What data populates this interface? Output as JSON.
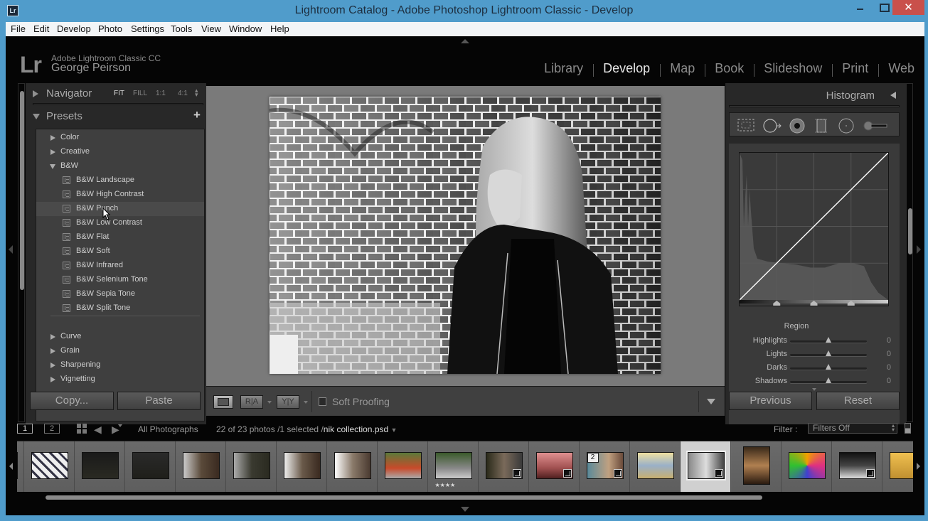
{
  "window": {
    "title": "Lightroom Catalog - Adobe Photoshop Lightroom Classic - Develop",
    "app_icon": "Lr",
    "close_glyph": "✕"
  },
  "menubar": [
    "File",
    "Edit",
    "Develop",
    "Photo",
    "Settings",
    "Tools",
    "View",
    "Window",
    "Help"
  ],
  "identity": {
    "logo": "Lr",
    "product": "Adobe Lightroom Classic CC",
    "user": "George Peirson"
  },
  "modules": [
    {
      "label": "Library",
      "active": false
    },
    {
      "label": "Develop",
      "active": true
    },
    {
      "label": "Map",
      "active": false
    },
    {
      "label": "Book",
      "active": false
    },
    {
      "label": "Slideshow",
      "active": false
    },
    {
      "label": "Print",
      "active": false
    },
    {
      "label": "Web",
      "active": false
    }
  ],
  "left_panel": {
    "navigator": {
      "title": "Navigator",
      "zoom_options": [
        "FIT",
        "FILL",
        "1:1",
        "4:1"
      ],
      "active_zoom": "FIT"
    },
    "presets": {
      "title": "Presets",
      "add_glyph": "+",
      "folders_top": [
        {
          "label": "Color",
          "expanded": false
        },
        {
          "label": "Creative",
          "expanded": false
        },
        {
          "label": "B&W",
          "expanded": true
        }
      ],
      "bw_presets": [
        "B&W Landscape",
        "B&W High Contrast",
        "B&W Punch",
        "B&W Low Contrast",
        "B&W Flat",
        "B&W Soft",
        "B&W Infrared",
        "B&W Selenium Tone",
        "B&W Sepia Tone",
        "B&W Split Tone"
      ],
      "hovered_preset": "B&W Punch",
      "folders_bottom": [
        {
          "label": "Curve",
          "expanded": false
        },
        {
          "label": "Grain",
          "expanded": false
        },
        {
          "label": "Sharpening",
          "expanded": false
        },
        {
          "label": "Vignetting",
          "expanded": false
        }
      ]
    },
    "copy_label": "Copy...",
    "paste_label": "Paste"
  },
  "toolbar": {
    "view_mode_icon": "loupe-view-icon",
    "before_after_ra": "R|A",
    "before_after_yy": "Y|Y",
    "soft_proofing_label": "Soft Proofing",
    "soft_proofing_checked": false
  },
  "right_panel": {
    "histogram_title": "Histogram",
    "tools": [
      "crop-overlay-icon",
      "spot-removal-icon",
      "red-eye-icon",
      "graduated-filter-icon",
      "radial-filter-icon",
      "adjustment-brush-icon"
    ],
    "tone_curve": {
      "region_title": "Region",
      "sliders": [
        {
          "label": "Highlights",
          "value": 0
        },
        {
          "label": "Lights",
          "value": 0
        },
        {
          "label": "Darks",
          "value": 0
        },
        {
          "label": "Shadows",
          "value": 0
        }
      ],
      "split_points": [
        0.25,
        0.5,
        0.75
      ]
    },
    "previous_label": "Previous",
    "reset_label": "Reset"
  },
  "filmstrip_bar": {
    "screen1": "1",
    "screen2": "2",
    "source": "All Photographs",
    "count_text": "22 of 23 photos /1 selected /",
    "filename": "nik collection.psd",
    "filter_label": "Filter :",
    "filter_value": "Filters Off"
  },
  "filmstrip": {
    "thumbnails": [
      {
        "desc": "partial white",
        "badge": true,
        "selected": false
      },
      {
        "desc": "cat on patterned wall",
        "badge": false,
        "selected": false
      },
      {
        "desc": "dark dining room",
        "badge": false,
        "selected": false
      },
      {
        "desc": "dark dining room 2",
        "badge": false,
        "selected": false
      },
      {
        "desc": "dining room",
        "badge": false,
        "selected": false
      },
      {
        "desc": "dining room 2",
        "badge": false,
        "selected": false
      },
      {
        "desc": "dining room bright",
        "badge": false,
        "selected": false
      },
      {
        "desc": "dining room bright 2",
        "badge": false,
        "selected": false
      },
      {
        "desc": "red bridge garden",
        "badge": false,
        "selected": false
      },
      {
        "desc": "deer",
        "badge": false,
        "selected": false,
        "stars": "★★★★"
      },
      {
        "desc": "woman with bike",
        "badge": true,
        "selected": false
      },
      {
        "desc": "pink sunset boat",
        "badge": true,
        "selected": false
      },
      {
        "desc": "woman portrait stack",
        "badge": true,
        "selected": false,
        "stack": "2"
      },
      {
        "desc": "woman sunglasses field",
        "badge": false,
        "selected": false
      },
      {
        "desc": "bw woman brick wall",
        "badge": true,
        "selected": true
      },
      {
        "desc": "woman portrait vertical",
        "badge": false,
        "selected": false
      },
      {
        "desc": "psychedelic dog",
        "badge": false,
        "selected": false
      },
      {
        "desc": "ballerina",
        "badge": true,
        "selected": false
      },
      {
        "desc": "partial yellow",
        "badge": false,
        "selected": false
      }
    ]
  },
  "colors": {
    "window_frame": "#509ccb",
    "close_button": "#c9504b",
    "panel_bg": "#282828",
    "canvas_bg": "#7a7a7a",
    "selected_cell": "#d0d0d0"
  }
}
